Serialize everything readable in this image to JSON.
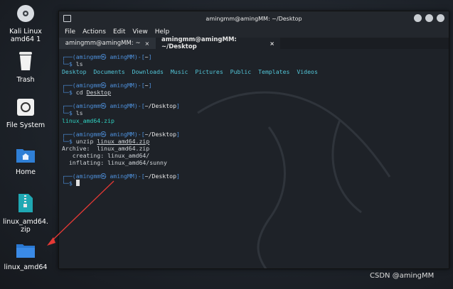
{
  "desktop": {
    "icons": [
      {
        "label_line1": "Kali Linux",
        "label_line2": "amd64 1",
        "icon": "disc-icon"
      },
      {
        "label": "Trash",
        "icon": "trash-icon"
      },
      {
        "label": "File System",
        "icon": "drive-icon"
      },
      {
        "label": "Home",
        "icon": "home-folder-icon"
      },
      {
        "label_line1": "linux_amd64.",
        "label_line2": "zip",
        "icon": "zip-file-icon"
      },
      {
        "label": "linux_amd64",
        "icon": "folder-icon"
      }
    ],
    "watermark": "CSDN @amingMM"
  },
  "window": {
    "title": "amingmm@amingMM: ~/Desktop",
    "menu": [
      "File",
      "Actions",
      "Edit",
      "View",
      "Help"
    ],
    "tabs": [
      {
        "label": "amingmm@amingMM: ~",
        "close": "×"
      },
      {
        "label": "amingmm@amingMM: ~/Desktop",
        "close": "×"
      }
    ]
  },
  "terminal": {
    "prompt_user": "amingmm㉿ amingMM",
    "home_dir": "~",
    "desktop_dir": "~/Desktop",
    "dollar": "$",
    "cmd1": "ls",
    "ls_home": [
      "Desktop",
      "Documents",
      "Downloads",
      "Music",
      "Pictures",
      "Public",
      "Templates",
      "Videos"
    ],
    "cmd2_prefix": "cd",
    "cmd2_arg": "Desktop",
    "cmd3": "ls",
    "ls_desktop": "linux_amd64.zip",
    "cmd4_prefix": "unzip",
    "cmd4_arg": "linux_amd64.zip",
    "out_archive": "Archive:  linux_amd64.zip",
    "out_creating": "   creating: linux_amd64/",
    "out_inflating": "  inflating: linux_amd64/sunny"
  },
  "colors": {
    "prompt_blue": "#4d8ed8",
    "dir_cyan": "#52c4d6",
    "zip_green": "#2fd0c0",
    "arrow_red": "#e53935"
  }
}
